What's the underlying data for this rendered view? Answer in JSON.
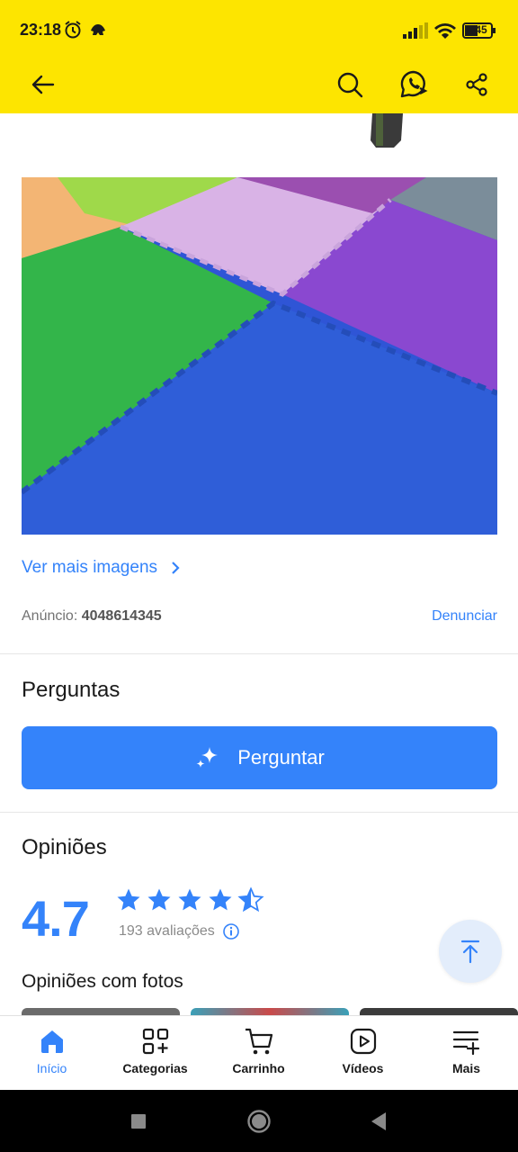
{
  "status_bar": {
    "time": "23:18",
    "battery": "45"
  },
  "colors": {
    "header_yellow": "#fde500",
    "accent_blue": "#3483fa",
    "fab_bg": "#e3edfb"
  },
  "header": {
    "icons": [
      "back-arrow-icon",
      "search-icon",
      "whatsapp-icon",
      "share-icon"
    ]
  },
  "gallery": {
    "see_more_label": "Ver mais imagens"
  },
  "ad": {
    "label": "Anúncio:",
    "number": "4048614345",
    "report_label": "Denunciar"
  },
  "questions": {
    "title": "Perguntas",
    "ask_button_label": "Perguntar"
  },
  "reviews": {
    "title": "Opiniões",
    "rating": "4.7",
    "stars_value": 4.7,
    "count_label": "193 avaliações",
    "photos_title": "Opiniões com fotos"
  },
  "bottom_nav": {
    "items": [
      {
        "label": "Início",
        "icon": "home-icon",
        "active": true
      },
      {
        "label": "Categorias",
        "icon": "categories-icon",
        "active": false
      },
      {
        "label": "Carrinho",
        "icon": "cart-icon",
        "active": false
      },
      {
        "label": "Vídeos",
        "icon": "video-icon",
        "active": false
      },
      {
        "label": "Mais",
        "icon": "more-menu-icon",
        "active": false
      }
    ]
  }
}
